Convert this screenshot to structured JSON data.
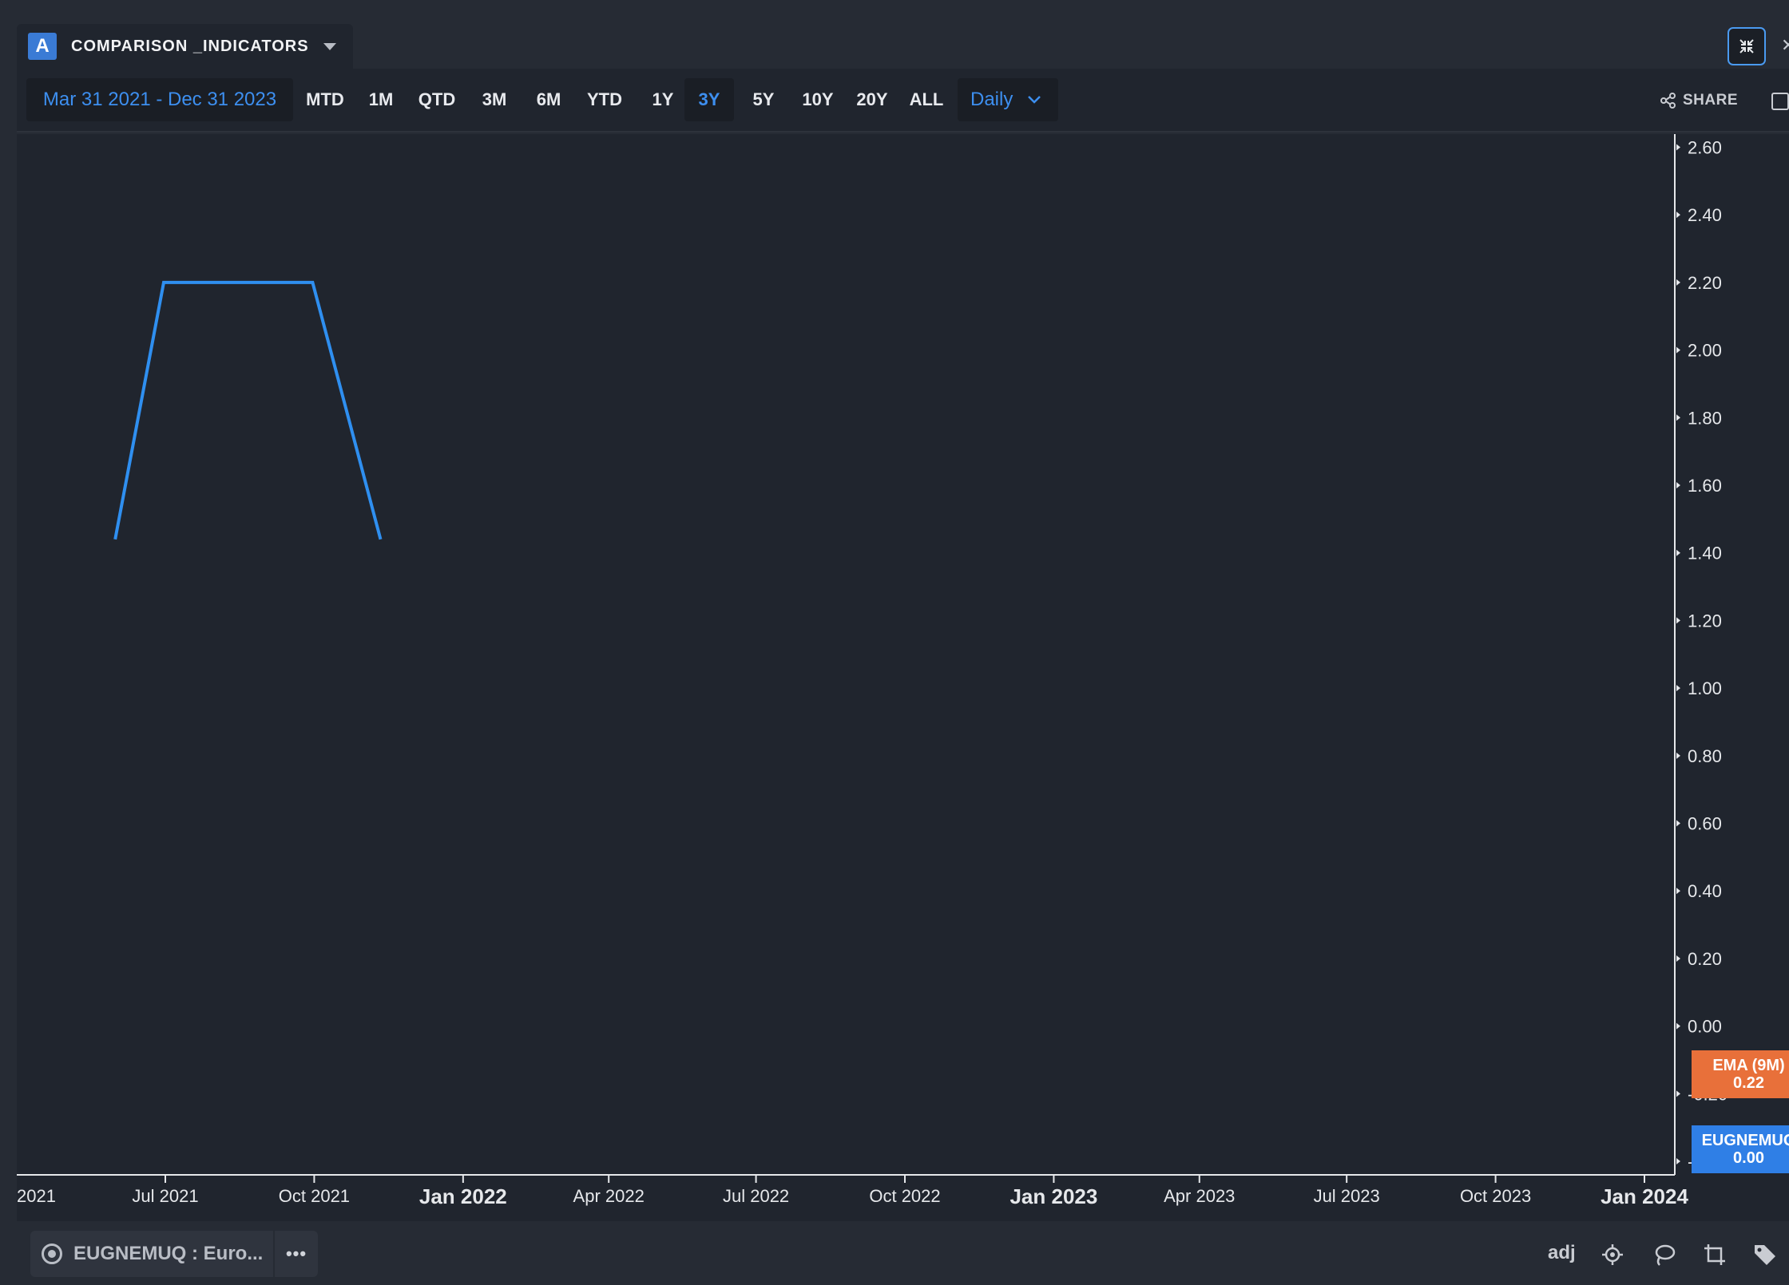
{
  "header": {
    "badge": "A",
    "title": "COMPARISON _INDICATORS"
  },
  "toolbar": {
    "date_range": "Mar 31 2021 - Dec 31 2023",
    "periods": [
      "MTD",
      "1M",
      "QTD",
      "3M",
      "6M",
      "YTD",
      "1Y",
      "3Y",
      "5Y",
      "10Y",
      "20Y",
      "ALL"
    ],
    "active_period": "3Y",
    "interval": "Daily",
    "share_label": "SHARE"
  },
  "chart_data": {
    "type": "line",
    "x_tick_labels": [
      "2021",
      "Jul 2021",
      "Oct 2021",
      "Jan 2022",
      "Apr 2022",
      "Jul 2022",
      "Oct 2022",
      "Jan 2023",
      "Apr 2023",
      "Jul 2023",
      "Oct 2023",
      "Jan 2024"
    ],
    "y_ticks": [
      "2.60",
      "2.40",
      "2.20",
      "2.00",
      "1.80",
      "1.60",
      "1.40",
      "1.20",
      "1.00",
      "0.80",
      "0.60",
      "0.40",
      "0.20",
      "0.00",
      "-0.20",
      "-0.40"
    ],
    "ylim": [
      -0.44,
      2.62
    ],
    "xlim": [
      "2021-03-31",
      "2024-01-01"
    ],
    "series": [
      {
        "color": "#2f8ff0",
        "points": [
          {
            "x": "2021-05-31",
            "y": 1.44
          },
          {
            "x": "2021-06-30",
            "y": 2.2
          },
          {
            "x": "2021-09-30",
            "y": 2.2
          },
          {
            "x": "2021-11-11",
            "y": 1.44
          }
        ]
      }
    ],
    "price_tags": [
      {
        "label": "EMA (9M)",
        "value": "0.22",
        "color": "#e8703a"
      },
      {
        "label": "EUGNEMUQ",
        "value": "0.00",
        "color": "#2f7fe6"
      }
    ],
    "legend": "none",
    "grid": false
  },
  "footer": {
    "series_label": "EUGNEMUQ : Euro...",
    "more_label": "•••",
    "adj_label": "adj",
    "icons": [
      "crosshair-icon",
      "lasso-icon",
      "crop-icon",
      "tag-icon"
    ]
  }
}
